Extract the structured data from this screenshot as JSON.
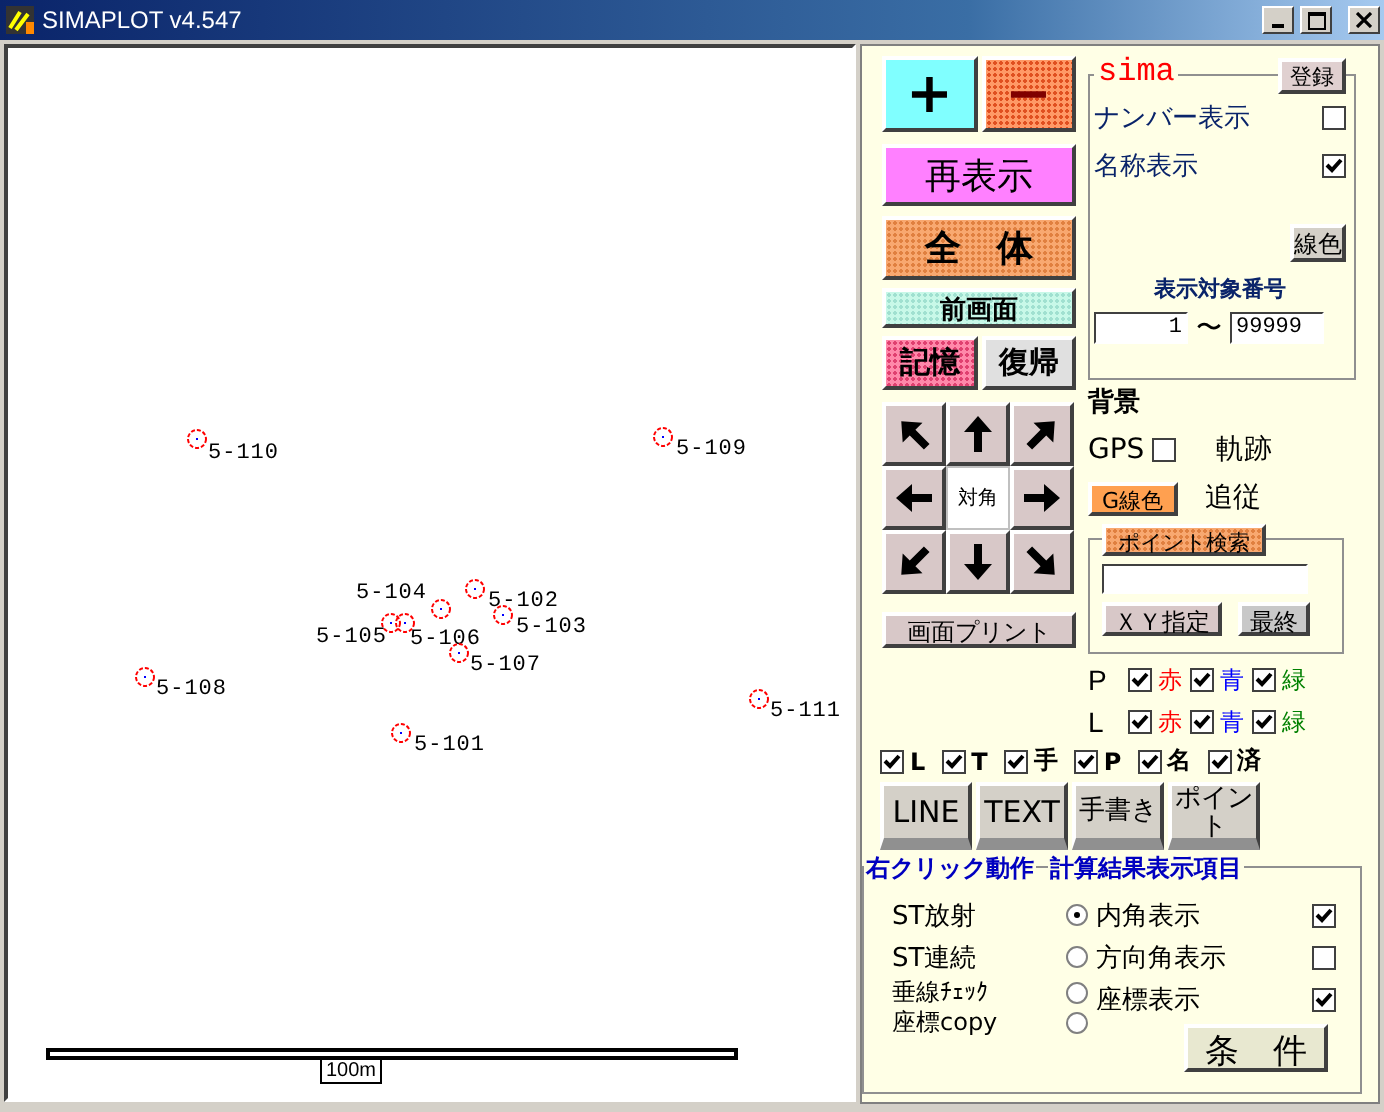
{
  "window": {
    "title": "SIMAPLOT v4.547"
  },
  "plot": {
    "points": [
      {
        "label": "5-110"
      },
      {
        "label": "5-109"
      },
      {
        "label": "5-104"
      },
      {
        "label": "5-102"
      },
      {
        "label": "5-105"
      },
      {
        "label": "5-106"
      },
      {
        "label": "5-103"
      },
      {
        "label": "5-107"
      },
      {
        "label": "5-108"
      },
      {
        "label": "5-111"
      },
      {
        "label": "5-101"
      }
    ],
    "scale_label": "100m"
  },
  "zoom_buttons": [
    {
      "kind": "plus",
      "label": "+"
    },
    {
      "kind": "minus",
      "label": "−"
    }
  ],
  "view_buttons": [
    {
      "kind": "redraw",
      "label": "再表示"
    },
    {
      "kind": "whole",
      "label": "全　体"
    },
    {
      "kind": "previous",
      "label": "前画面"
    }
  ],
  "memory_buttons": [
    {
      "kind": "store",
      "label": "記憶"
    },
    {
      "kind": "restore",
      "label": "復帰"
    }
  ],
  "pan_center": "対角",
  "print_button": "画面プリント",
  "sima": {
    "legend": "sima",
    "register_button": "登録",
    "options": [
      {
        "label": "ナンバー表示",
        "checked": false
      },
      {
        "label": "名称表示",
        "checked": true
      }
    ],
    "line_color_button": "線色",
    "range_label": "表示対象番号",
    "range_from": "1",
    "range_separator": "〜",
    "range_to": "99999"
  },
  "background": {
    "label": "背景",
    "gps_label": "GPS",
    "gps_checked": false,
    "track_label": "軌跡",
    "g_line_color_button": "G線色",
    "follow_label": "追従"
  },
  "point_search": {
    "legend_button": "ポイント検索",
    "xy_button": "ＸＹ指定",
    "last_button": "最終"
  },
  "color_filters": [
    {
      "label": "P",
      "options": [
        {
          "label": "赤",
          "checked": true,
          "color": "#ff0000"
        },
        {
          "label": "青",
          "checked": true,
          "color": "#0000ff"
        },
        {
          "label": "緑",
          "checked": true,
          "color": "#008000"
        }
      ]
    },
    {
      "label": "L",
      "options": [
        {
          "label": "赤",
          "checked": true,
          "color": "#ff0000"
        },
        {
          "label": "青",
          "checked": true,
          "color": "#0000ff"
        },
        {
          "label": "緑",
          "checked": true,
          "color": "#008000"
        }
      ]
    }
  ],
  "layer_toggles": [
    {
      "label": "L",
      "checked": true
    },
    {
      "label": "T",
      "checked": true
    },
    {
      "label": "手",
      "checked": true
    },
    {
      "label": "P",
      "checked": true
    },
    {
      "label": "名",
      "checked": true
    },
    {
      "label": "済",
      "checked": true
    }
  ],
  "mode_buttons": [
    {
      "label": "LINE"
    },
    {
      "label": "TEXT"
    },
    {
      "label": "手書き"
    },
    {
      "label": "ポイント"
    }
  ],
  "right_click": {
    "legend": "右クリック動作",
    "options": [
      {
        "label": "ST放射",
        "selected": true
      },
      {
        "label": "ST連続",
        "selected": false
      },
      {
        "label": "垂線ﾁｪｯｸ",
        "selected": false
      },
      {
        "label": "座標copy",
        "selected": false
      }
    ]
  },
  "result_display": {
    "legend": "計算結果表示項目",
    "options": [
      {
        "label": "内角表示",
        "checked": true
      },
      {
        "label": "方向角表示",
        "checked": false
      },
      {
        "label": "座標表示",
        "checked": true
      }
    ]
  },
  "condition_button": "条　件"
}
